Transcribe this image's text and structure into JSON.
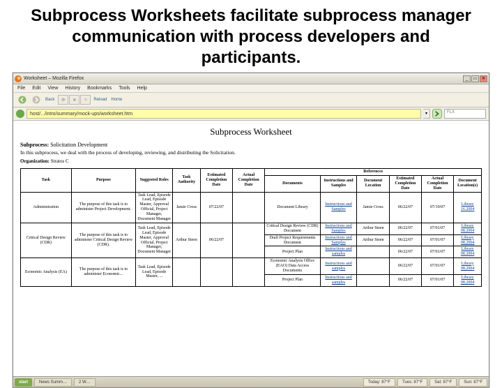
{
  "slide": {
    "title": "Subprocess Worksheets facilitate subprocess manager communication with process developers and participants."
  },
  "window": {
    "title": "Worksheet – Mozilla Firefox",
    "minimize": "_",
    "maximize": "▭",
    "close": "✕"
  },
  "menu": {
    "file": "File",
    "edit": "Edit",
    "view": "View",
    "history": "History",
    "bookmarks": "Bookmarks",
    "tools": "Tools",
    "help": "Help"
  },
  "toolbar": {
    "label_back": "Back",
    "label_reload": "Reload",
    "label_home": "Home"
  },
  "address": {
    "url": "host/.../intro/summary/mock-ups/worksheet.htm",
    "dropdown": "▾",
    "search_placeholder": "FLX"
  },
  "doc": {
    "title": "Subprocess Worksheet",
    "subprocess_label": "Subprocess:",
    "subprocess_name": "Solicitation Development",
    "intro": "In this subprocess, we deal with the process of developing, reviewing, and distributing the Solicitation.",
    "org_label": "Organization:",
    "org_name": "Stratos C"
  },
  "headers": {
    "task": "Task",
    "purpose": "Purpose",
    "roles": "Suggested Roles",
    "authority": "Task Authority",
    "est": "Estimated Completion Date",
    "act": "Actual Completion Date",
    "ref": "References",
    "docs": "Documents",
    "inst": "Instructions and Samples",
    "dloc": "Document Location",
    "rest": "Estimated Completion Date",
    "ract": "Actual Completion Date",
    "rloc": "Document Location(s)"
  },
  "rows": [
    {
      "task": "Administration",
      "purpose": "The purpose of this task is to administer Project Development.",
      "roles": "Task Lead, Episode Lead, Episode Master, Approval Official, Project Manager, Document Manager",
      "authority": "Jamie Cross",
      "est": "07/22/07",
      "act": "",
      "doc": "Document Library",
      "inst": "Instructions and Samples",
      "dloc": "Jamie Cross",
      "rest": "06/22/07",
      "ract": "07/19/07",
      "rloc": "Library 16.2004"
    },
    {
      "task": "Critical Design Review (CDR)",
      "purpose": "The purpose of this task is to administer Critical Design Review (CDR).",
      "roles": "Task Lead, Episode Lead, Episode Master, Approval Official, Project Manager, Document Manager",
      "authority": "Arthur Steen",
      "est": "06/22/07",
      "act": "",
      "subrows": [
        {
          "doc": "Critical Design Review (CDR) Document",
          "inst": "Instructions and Samples",
          "dloc": "Arthur Steen",
          "rest": "06/22/07",
          "ract": "07/01/07",
          "rloc": "Library 08.2004"
        },
        {
          "doc": "Draft Project Requirements Document",
          "inst": "Instructions and Samples",
          "dloc": "Arthur Steen",
          "rest": "06/22/07",
          "ract": "07/01/07",
          "rloc": "Library 08.2004"
        },
        {
          "doc": "Project Plan",
          "inst": "Instructions and samples",
          "dloc": "",
          "rest": "06/22/07",
          "ract": "07/01/07",
          "rloc": "Library 08.2004"
        }
      ]
    },
    {
      "task": "Economic Analysis (EA)",
      "purpose": "The purpose of this task is to administer Economic...",
      "roles": "Task Lead, Episode Lead, Episode Master, ...",
      "authority": "",
      "est": "",
      "act": "",
      "subrows": [
        {
          "doc": "Economic Analysis Office (EAO) Data Access Documents",
          "inst": "Instructions and samples",
          "dloc": "",
          "rest": "06/22/07",
          "ract": "07/01/07",
          "rloc": "Library 08.2004"
        },
        {
          "doc": "Project Plan",
          "inst": "Instructions and samples",
          "dloc": "",
          "rest": "06/22/07",
          "ract": "07/01/07",
          "rloc": "Library 08.2004"
        }
      ]
    }
  ],
  "taskbar": {
    "start": "start",
    "items": [
      "News Summ…",
      "2 W…"
    ],
    "tray": [
      "Today: 87°F",
      "Tues: 87°F",
      "Sat: 87°F",
      "Sun: 87°F"
    ]
  }
}
